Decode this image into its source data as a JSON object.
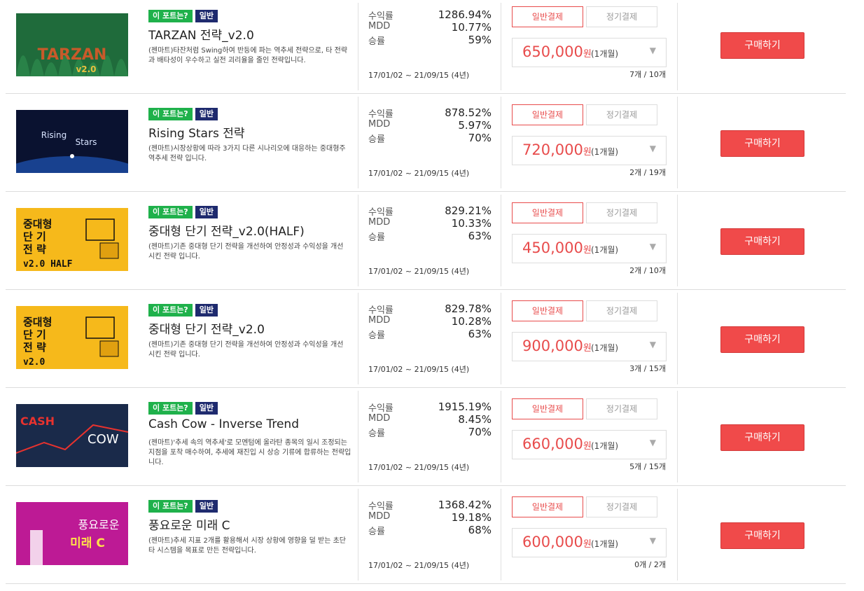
{
  "products": [
    {
      "badges": [
        "이 포트는?",
        "일반"
      ],
      "title": "TARZAN 전략_v2.0",
      "desc": "(젠마트)타잔처럼 Swing하여 반등에 파는 역추세 전략으로, 타 전략과 배타성이 우수하고 실전 괴리율을 줄인 전략입니다.",
      "stat_labels": [
        "수익률",
        "MDD",
        "승률"
      ],
      "stat_values": [
        "1286.94%",
        "10.77%",
        "59%"
      ],
      "period": "17/01/02 ~ 21/09/15 (4년)",
      "pay_tabs": [
        "일반결제",
        "정기결제"
      ],
      "price": "650,000",
      "price_unit": "원",
      "period_option": "(1개월)",
      "stock": "7개 / 10개",
      "buy_label": "구매하기",
      "thumb_text": "TARZAN",
      "thumb_sub": "v2.0"
    },
    {
      "badges": [
        "이 포트는?",
        "일반"
      ],
      "title": "Rising Stars 전략",
      "desc": "(젠마트)시장상황에 따라 3가지 다른 시나리오에 대응하는 중대형주 역추세 전략 입니다.",
      "stat_labels": [
        "수익률",
        "MDD",
        "승률"
      ],
      "stat_values": [
        "878.52%",
        "5.97%",
        "70%"
      ],
      "period": "17/01/02 ~ 21/09/15 (4년)",
      "pay_tabs": [
        "일반결제",
        "정기결제"
      ],
      "price": "720,000",
      "price_unit": "원",
      "period_option": "(1개월)",
      "stock": "2개 / 19개",
      "buy_label": "구매하기",
      "thumb_text": "Rising",
      "thumb_sub": "Stars"
    },
    {
      "badges": [
        "이 포트는?",
        "일반"
      ],
      "title": "중대형 단기 전략_v2.0(HALF)",
      "desc": "(젠마트)기존 중대형 단기 전략을 개선하여 안정성과 수익성을 개선 시킨 전략 입니다.",
      "stat_labels": [
        "수익률",
        "MDD",
        "승률"
      ],
      "stat_values": [
        "829.21%",
        "10.33%",
        "63%"
      ],
      "period": "17/01/02 ~ 21/09/15 (4년)",
      "pay_tabs": [
        "일반결제",
        "정기결제"
      ],
      "price": "450,000",
      "price_unit": "원",
      "period_option": "(1개월)",
      "stock": "2개 / 10개",
      "buy_label": "구매하기",
      "thumb_text": "중대형 단 기 전 략",
      "thumb_sub": "v2.0 HALF"
    },
    {
      "badges": [
        "이 포트는?",
        "일반"
      ],
      "title": "중대형 단기 전략_v2.0",
      "desc": "(젠마트)기존 중대형 단기 전략을 개선하여 안정성과 수익성을 개선 시킨 전략 입니다.",
      "stat_labels": [
        "수익률",
        "MDD",
        "승률"
      ],
      "stat_values": [
        "829.78%",
        "10.28%",
        "63%"
      ],
      "period": "17/01/02 ~ 21/09/15 (4년)",
      "pay_tabs": [
        "일반결제",
        "정기결제"
      ],
      "price": "900,000",
      "price_unit": "원",
      "period_option": "(1개월)",
      "stock": "3개 / 15개",
      "buy_label": "구매하기",
      "thumb_text": "중대형 단 기 전 략",
      "thumb_sub": "v2.0"
    },
    {
      "badges": [
        "이 포트는?",
        "일반"
      ],
      "title": "Cash Cow - Inverse Trend",
      "desc": "(젠마트)'추세 속의 역추세'로 모멘텀에 올라탄 종목의 일시 조정되는 지점을 포착 매수하여, 추세에 재진입 시 상승 기류에 합류하는 전략입니다.",
      "stat_labels": [
        "수익률",
        "MDD",
        "승률"
      ],
      "stat_values": [
        "1915.19%",
        "8.45%",
        "70%"
      ],
      "period": "17/01/02 ~ 21/09/15 (4년)",
      "pay_tabs": [
        "일반결제",
        "정기결제"
      ],
      "price": "660,000",
      "price_unit": "원",
      "period_option": "(1개월)",
      "stock": "5개 / 15개",
      "buy_label": "구매하기",
      "thumb_text": "CASH",
      "thumb_sub": "COW"
    },
    {
      "badges": [
        "이 포트는?",
        "일반"
      ],
      "title": "풍요로운 미래 C",
      "desc": "(젠마트)추세 지표 2개를 활용해서 시장 상황에 영향을 덜 받는 초단타 시스템을 목표로 만든 전략입니다.",
      "stat_labels": [
        "수익률",
        "MDD",
        "승률"
      ],
      "stat_values": [
        "1368.42%",
        "19.18%",
        "68%"
      ],
      "period": "17/01/02 ~ 21/09/15 (4년)",
      "pay_tabs": [
        "일반결제",
        "정기결제"
      ],
      "price": "600,000",
      "price_unit": "원",
      "period_option": "(1개월)",
      "stock": "0개 / 2개",
      "buy_label": "구매하기",
      "thumb_text": "풍요로운",
      "thumb_sub": "미래 C"
    }
  ],
  "colors": {
    "accent_red": "#e84c4c",
    "button_red": "#f04a4a",
    "badge_green": "#1fb14b",
    "badge_navy": "#1e2a6e"
  }
}
